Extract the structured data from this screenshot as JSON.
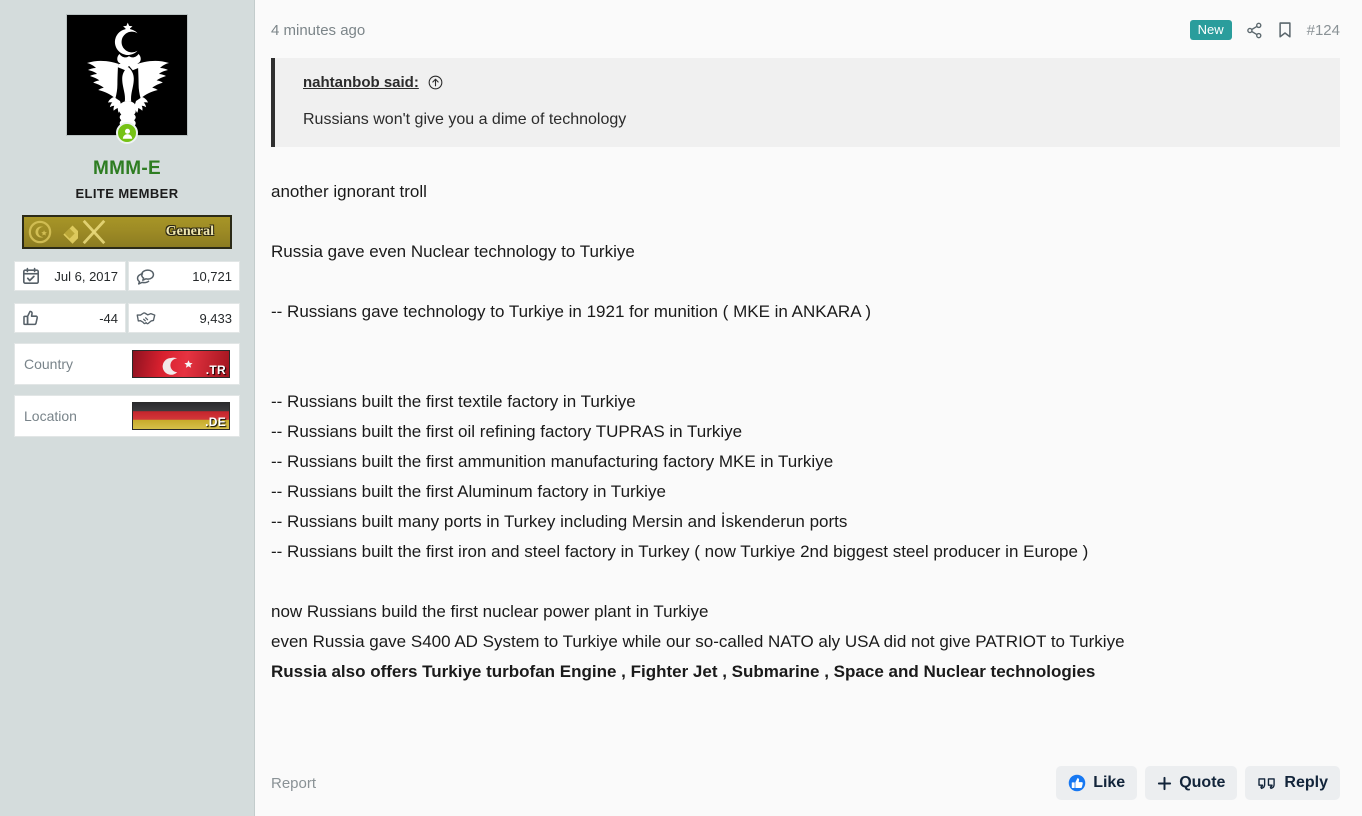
{
  "sidebar": {
    "avatar_icon": "double-headed-eagle-emblem",
    "online_status_icon": "online-user-icon",
    "username": "MMM-E",
    "user_title": "ELITE MEMBER",
    "rank": {
      "label": "General",
      "icons": [
        "crescent-star-medal-icon",
        "diamond-medal-icon",
        "crossed-swords-icon"
      ]
    },
    "stats": [
      {
        "icon": "calendar-icon",
        "value": "Jul 6, 2017"
      },
      {
        "icon": "messages-icon",
        "value": "10,721"
      },
      {
        "icon": "thumbs-up-icon",
        "value": "-44"
      },
      {
        "icon": "handshake-icon",
        "value": "9,433"
      }
    ],
    "info": [
      {
        "label": "Country",
        "flag": "turkey-flag",
        "tld": ".TR"
      },
      {
        "label": "Location",
        "flag": "germany-flag",
        "tld": ".DE"
      }
    ]
  },
  "post": {
    "timestamp": "4 minutes ago",
    "new_badge": "New",
    "share_icon": "share-nodes-icon",
    "bookmark_icon": "bookmark-icon",
    "post_number": "#124",
    "quote": {
      "author_said": "nahtanbob said:",
      "jump_icon": "jump-to-post-arrow-icon",
      "text": "Russians won't give you a dime of technology"
    },
    "body": {
      "p1": "another ignorant troll",
      "p2": "Russia gave even Nuclear technology to Turkiye",
      "p3": "-- Russians gave technology to Turkiye in 1921 for munition ( MKE in ANKARA )",
      "list": [
        "-- Russians built the first textile factory in Turkiye",
        "-- Russians built the first oil refining factory TUPRAS in Turkiye",
        "-- Russians built the first ammunition manufacturing factory MKE in Turkiye",
        "-- Russians built the first Aluminum factory in Turkiye",
        "-- Russians built many ports in Turkey including Mersin and İskenderun ports",
        "-- Russians built the first iron and steel factory in Turkey ( now Turkiye 2nd biggest steel producer in Europe )"
      ],
      "p4_line1": "now Russians build the first nuclear power plant in Turkiye",
      "p4_line2": "even Russia gave S400 AD System to Turkiye while our so-called NATO aly USA did not give PATRIOT to Turkiye",
      "p4_line3_bold": "Russia also offers Turkiye turbofan Engine , Fighter Jet , Submarine , Space and Nuclear technologies"
    },
    "footer": {
      "report_label": "Report",
      "like_label": "Like",
      "like_icon": "thumbs-up-circle-icon",
      "quote_label": "Quote",
      "quote_icon": "plus-icon",
      "reply_label": "Reply",
      "reply_icon": "quote-marks-icon"
    }
  },
  "colors": {
    "sidebar_bg": "#d4dcdc",
    "content_bg": "#fafafa",
    "username": "#2e7d22",
    "badge_new": "#2a9d9c",
    "quote_bg": "#f0f0f0",
    "like_icon": "#1778f2",
    "online": "#76c216"
  }
}
